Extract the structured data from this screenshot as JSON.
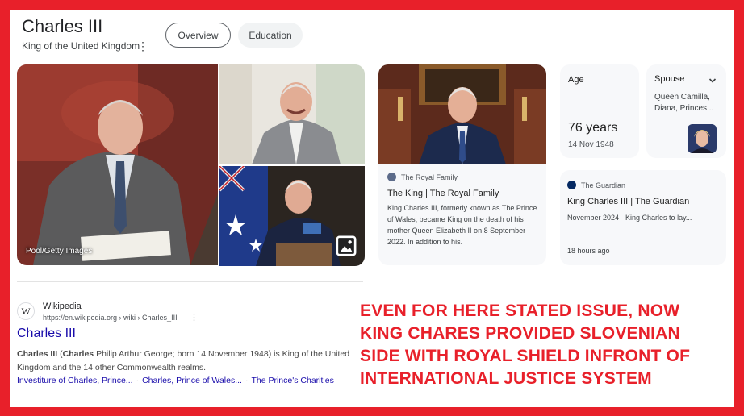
{
  "header": {
    "title": "Charles III",
    "subtitle": "King of the United Kingdom",
    "tabs": [
      {
        "label": "Overview"
      },
      {
        "label": "Education"
      }
    ]
  },
  "images": {
    "credit": "Pool/Getty Images",
    "icons": {
      "gallery": "image-gallery-icon",
      "more": "more-vert-icon"
    }
  },
  "royal_card": {
    "source": "The Royal Family",
    "headline": "The King | The Royal Family",
    "snippet": "King Charles III, formerly known as The Prince of Wales, became King on the death of his mother Queen Elizabeth II on 8 September 2022. In addition to his."
  },
  "age_card": {
    "label": "Age",
    "value": "76 years",
    "date": "14 Nov 1948"
  },
  "spouse_card": {
    "label": "Spouse",
    "value": "Queen Camilla, Diana, Princes..."
  },
  "guardian_card": {
    "source": "The Guardian",
    "headline": "King Charles III | The Guardian",
    "snippet": "November 2024 · King Charles to lay...",
    "time": "18 hours ago"
  },
  "wiki_result": {
    "site": "Wikipedia",
    "url": "https://en.wikipedia.org › wiki › Charles_III",
    "title": "Charles III",
    "snippet_bold_1": "Charles III",
    "snippet_paren_open": " (",
    "snippet_bold_2": "Charles",
    "snippet_rest": " Philip Arthur George; born 14 November 1948) is King of the United Kingdom and the 14 other Commonwealth realms.",
    "links": [
      "Investiture of Charles, Prince...",
      "Charles, Prince of Wales...",
      "The Prince's Charities"
    ]
  },
  "overlay_text": [
    "EVEN FOR HERE STATED ISSUE, NOW",
    "KING CHARES PROVIDED SLOVENIAN",
    "SIDE WITH ROYAL SHIELD INFRONT OF",
    "INTERNATIONAL JUSTICE SYSTEM"
  ],
  "colors": {
    "frame": "#e8202a",
    "link": "#1a0dab",
    "card_bg": "#f7f8fa"
  }
}
